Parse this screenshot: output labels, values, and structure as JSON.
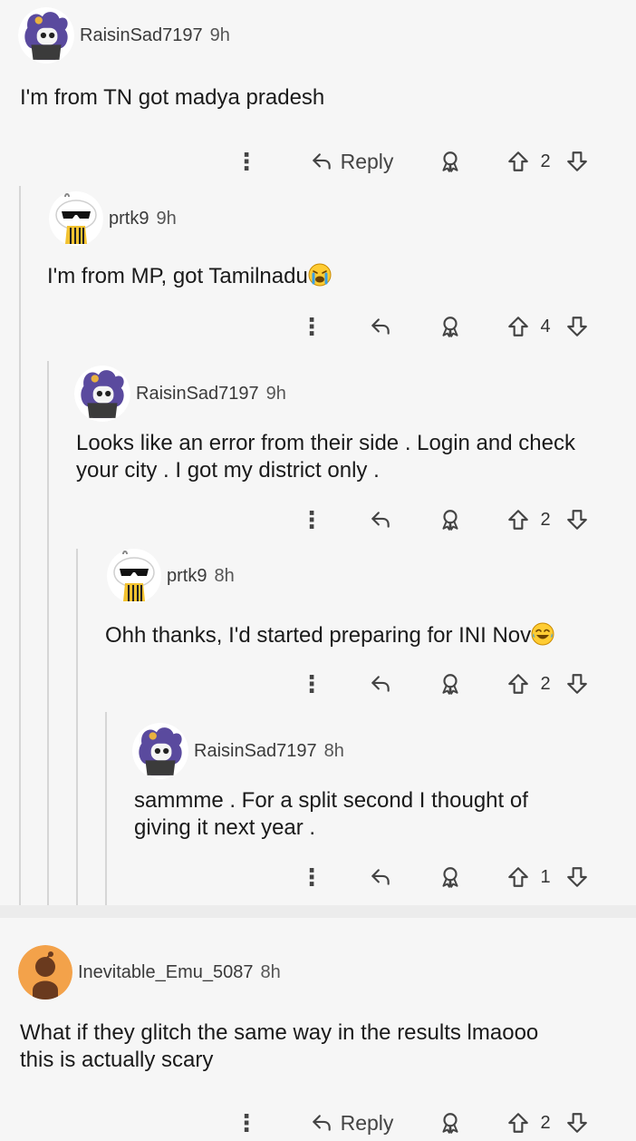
{
  "comments": [
    {
      "username": "RaisinSad7197",
      "time": "9h",
      "body": "I'm from TN got madya pradesh",
      "reply_label": "Reply",
      "votes": "2"
    },
    {
      "username": "prtk9",
      "time": "9h",
      "body": "I'm from MP, got Tamilnadu",
      "votes": "4"
    },
    {
      "username": "RaisinSad7197",
      "time": "9h",
      "body_line1": "Looks like an error from their side . Login and check",
      "body_line2": "your city . I got my district only .",
      "votes": "2"
    },
    {
      "username": "prtk9",
      "time": "8h",
      "body": "Ohh thanks, I'd started preparing for INI Nov",
      "votes": "2"
    },
    {
      "username": "RaisinSad7197",
      "time": "8h",
      "body_line1": "sammme . For a split second I thought of",
      "body_line2": "giving it next year .",
      "votes": "1"
    }
  ],
  "second_thread": {
    "username": "Inevitable_Emu_5087",
    "time": "8h",
    "body_line1": "What if they glitch the same way in the results lmaooo",
    "body_line2": "this is actually scary",
    "reply_label": "Reply",
    "votes": "2"
  },
  "icons": {
    "more": "kebab-menu-icon",
    "reply": "reply-arrow-icon",
    "award": "award-icon",
    "upvote": "upvote-arrow-icon",
    "downvote": "downvote-arrow-icon"
  },
  "colors": {
    "background": "#f6f6f6",
    "thread_line": "#d6d6d6",
    "emu_avatar_bg": "#f3a24a"
  }
}
